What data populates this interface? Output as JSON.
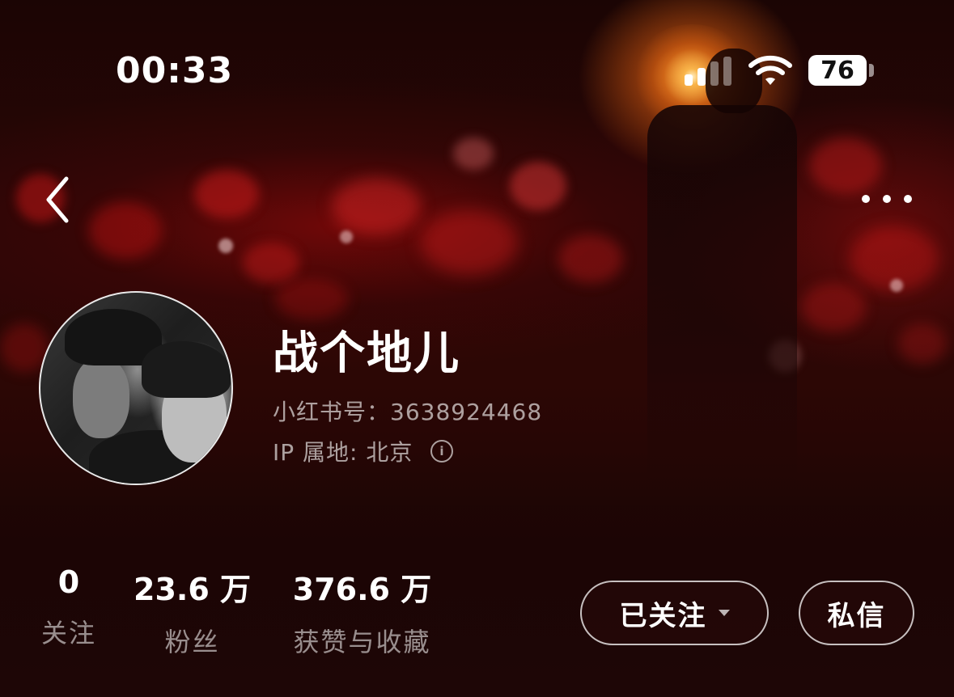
{
  "status_bar": {
    "time": "00:33",
    "battery": "76"
  },
  "nav": {
    "back_icon": "chevron-left-icon",
    "more_icon": "more-horizontal-icon"
  },
  "profile": {
    "name": "战个地儿",
    "red_id": "小红书号：3638924468",
    "ip_location": "IP 属地: 北京",
    "info_icon": "info-icon"
  },
  "stats": [
    {
      "value": "0",
      "label": "关注"
    },
    {
      "value": "23.6 万",
      "label": "粉丝"
    },
    {
      "value": "376.6 万",
      "label": "获赞与收藏"
    }
  ],
  "actions": {
    "follow_label": "已关注",
    "message_label": "私信"
  },
  "colors": {
    "background": "#2a0606",
    "text_primary": "#ffffff",
    "text_secondary": "rgba(255,255,255,0.62)"
  }
}
